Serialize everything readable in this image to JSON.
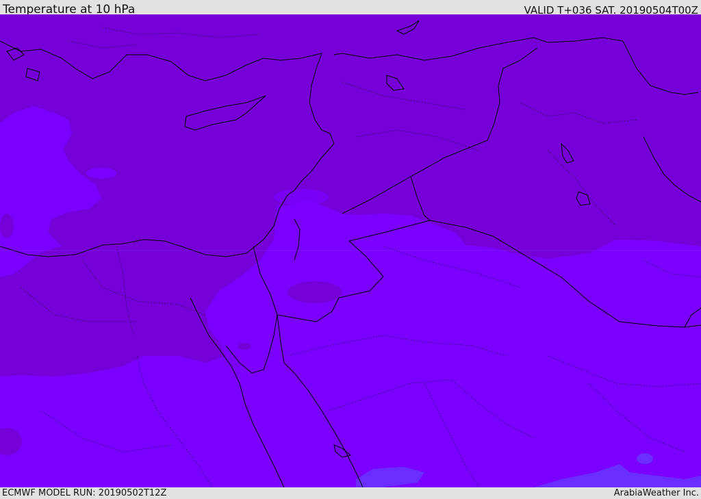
{
  "header": {
    "title": "Temperature at 10 hPa",
    "valid": "VALID T+036 SAT. 20190504T00Z"
  },
  "footer": {
    "model_run": "ECMWF MODEL RUN: 20190502T12Z",
    "credit": "ArabiaWeather Inc."
  },
  "colors": {
    "background": "#e2e2e2",
    "temp_band_darker": "#7600d8",
    "temp_band_main": "#7a00ff",
    "temp_band_lighter": "#6a2cff",
    "coastline": "#000000"
  }
}
